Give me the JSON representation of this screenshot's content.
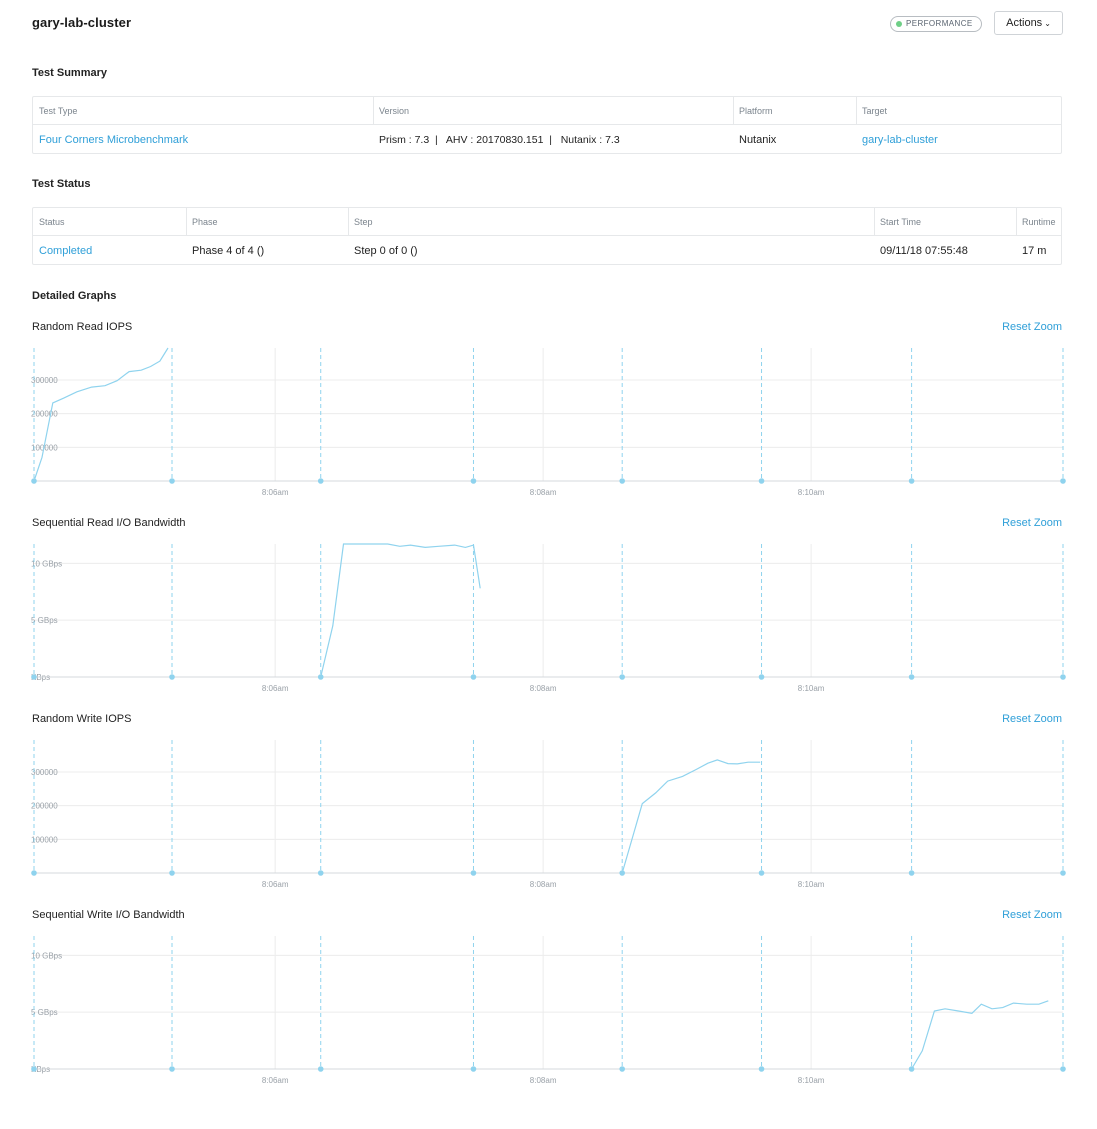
{
  "header": {
    "title": "gary-lab-cluster",
    "badge": "PERFORMANCE",
    "actions_label": "Actions",
    "colors": {
      "badge_dot": "#6fcf87",
      "link": "#2f9fd8",
      "series": "#8fd3ee"
    }
  },
  "summary": {
    "title": "Test Summary",
    "columns": [
      "Test Type",
      "Version",
      "Platform",
      "Target"
    ],
    "row": {
      "test_type": "Four Corners Microbenchmark",
      "version": "Prism : 7.3  |   AHV : 20170830.151  |   Nutanix : 7.3",
      "platform": "Nutanix",
      "target": "gary-lab-cluster"
    }
  },
  "status": {
    "title": "Test Status",
    "columns": [
      "Status",
      "Phase",
      "Step",
      "Start Time",
      "Runtime"
    ],
    "row": {
      "status": "Completed",
      "phase": "Phase 4 of 4 ()",
      "step": "Step 0 of 0 ()",
      "start_time": "09/11/18 07:55:48",
      "runtime": "17 m"
    }
  },
  "graphs": {
    "title": "Detailed Graphs",
    "reset_zoom_label": "Reset Zoom"
  },
  "chart_data": [
    {
      "type": "line",
      "title": "Random Read IOPS",
      "x_unit": "minutes",
      "x_ticks": [
        {
          "x": 6,
          "label": "8:06am"
        },
        {
          "x": 8,
          "label": "8:08am"
        },
        {
          "x": 10,
          "label": "8:10am"
        }
      ],
      "y_ticks": [
        {
          "y": 100000,
          "label": "100000"
        },
        {
          "y": 200000,
          "label": "200000"
        },
        {
          "y": 300000,
          "label": "300000"
        }
      ],
      "xlim": [
        4.2,
        11.88
      ],
      "ylim": [
        0,
        395000
      ],
      "phase_markers": [
        4.2,
        5.23,
        6.34,
        7.48,
        8.59,
        9.63,
        10.75,
        11.88
      ],
      "series": [
        {
          "x": [
            4.2,
            4.26,
            4.34,
            4.42,
            4.52,
            4.63,
            4.73,
            4.82,
            4.91,
            5.0,
            5.07,
            5.14,
            5.2
          ],
          "y": [
            0,
            70000,
            232000,
            246000,
            265000,
            279000,
            283000,
            298000,
            325000,
            329000,
            340000,
            356000,
            395000
          ]
        }
      ]
    },
    {
      "type": "line",
      "title": "Sequential Read I/O Bandwidth",
      "x_unit": "minutes",
      "x_ticks": [
        {
          "x": 6,
          "label": "8:06am"
        },
        {
          "x": 8,
          "label": "8:08am"
        },
        {
          "x": 10,
          "label": "8:10am"
        }
      ],
      "y_ticks": [
        {
          "y": 0,
          "label": "KBps"
        },
        {
          "y": 5,
          "label": "5 GBps"
        },
        {
          "y": 10,
          "label": "10 GBps"
        }
      ],
      "xlim": [
        4.2,
        11.88
      ],
      "ylim": [
        0,
        11.7
      ],
      "phase_markers": [
        4.2,
        5.23,
        6.34,
        7.48,
        8.59,
        9.63,
        10.75,
        11.88
      ],
      "series": [
        {
          "x": [
            6.34,
            6.43,
            6.51,
            6.67,
            6.84,
            6.93,
            7.01,
            7.12,
            7.22,
            7.34,
            7.42,
            7.48,
            7.53
          ],
          "y": [
            0,
            4.5,
            11.7,
            11.7,
            11.7,
            11.5,
            11.6,
            11.4,
            11.5,
            11.6,
            11.4,
            11.6,
            7.8
          ]
        }
      ]
    },
    {
      "type": "line",
      "title": "Random Write IOPS",
      "x_unit": "minutes",
      "x_ticks": [
        {
          "x": 6,
          "label": "8:06am"
        },
        {
          "x": 8,
          "label": "8:08am"
        },
        {
          "x": 10,
          "label": "8:10am"
        }
      ],
      "y_ticks": [
        {
          "y": 100000,
          "label": "100000"
        },
        {
          "y": 200000,
          "label": "200000"
        },
        {
          "y": 300000,
          "label": "300000"
        }
      ],
      "xlim": [
        4.2,
        11.88
      ],
      "ylim": [
        0,
        395000
      ],
      "phase_markers": [
        4.2,
        5.23,
        6.34,
        7.48,
        8.59,
        9.63,
        10.75,
        11.88
      ],
      "series": [
        {
          "x": [
            8.59,
            8.74,
            8.84,
            8.93,
            9.04,
            9.14,
            9.23,
            9.3,
            9.38,
            9.45,
            9.53,
            9.62
          ],
          "y": [
            0,
            206000,
            238000,
            273000,
            287000,
            307000,
            326000,
            336000,
            325000,
            324000,
            329000,
            329000
          ]
        }
      ]
    },
    {
      "type": "line",
      "title": "Sequential Write I/O Bandwidth",
      "x_unit": "minutes",
      "x_ticks": [
        {
          "x": 6,
          "label": "8:06am"
        },
        {
          "x": 8,
          "label": "8:08am"
        },
        {
          "x": 10,
          "label": "8:10am"
        }
      ],
      "y_ticks": [
        {
          "y": 0,
          "label": "KBps"
        },
        {
          "y": 5,
          "label": "5 GBps"
        },
        {
          "y": 10,
          "label": "10 GBps"
        }
      ],
      "xlim": [
        4.2,
        11.88
      ],
      "ylim": [
        0,
        11.7
      ],
      "phase_markers": [
        4.2,
        5.23,
        6.34,
        7.48,
        8.59,
        9.63,
        10.75,
        11.88
      ],
      "series": [
        {
          "x": [
            10.75,
            10.83,
            10.92,
            11.0,
            11.1,
            11.2,
            11.27,
            11.35,
            11.43,
            11.51,
            11.61,
            11.7,
            11.77
          ],
          "y": [
            0,
            1.6,
            5.1,
            5.3,
            5.1,
            4.9,
            5.7,
            5.3,
            5.4,
            5.8,
            5.7,
            5.7,
            6.0
          ]
        }
      ]
    }
  ]
}
